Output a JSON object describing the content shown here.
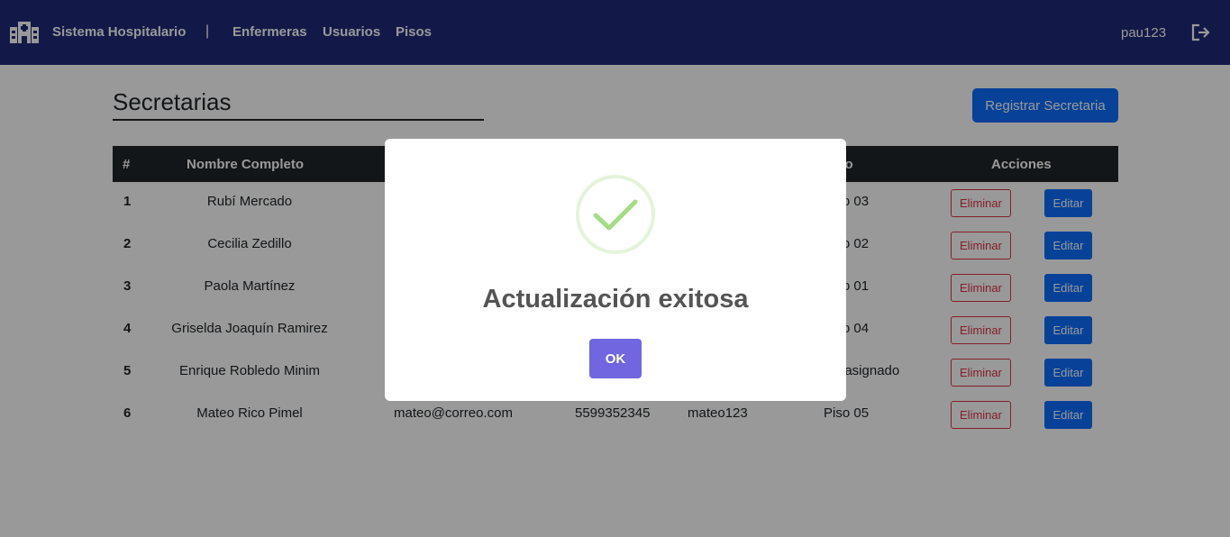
{
  "nav": {
    "brand": "Sistema Hospitalario",
    "separator": "|",
    "links": [
      "Enfermeras",
      "Usuarios",
      "Pisos"
    ],
    "user": "pau123"
  },
  "page": {
    "title": "Secretarias",
    "register_button": "Registrar Secretaria"
  },
  "table": {
    "headers": [
      "#",
      "Nombre Completo",
      "Piso",
      "Acciones"
    ],
    "rows": [
      {
        "num": "1",
        "name": "Rubí Mercado",
        "email": "",
        "phone": "",
        "user": "",
        "floor": "Piso 03"
      },
      {
        "num": "2",
        "name": "Cecilia Zedillo",
        "email": "",
        "phone": "",
        "user": "",
        "floor": "Piso 02"
      },
      {
        "num": "3",
        "name": "Paola Martínez",
        "email": "",
        "phone": "",
        "user": "",
        "floor": "Piso 01"
      },
      {
        "num": "4",
        "name": "Griselda Joaquín Ramirez",
        "email": "",
        "phone": "",
        "user": "",
        "floor": "Piso 04"
      },
      {
        "num": "5",
        "name": "Enrique Robledo Minim",
        "email": "",
        "phone": "",
        "user": "",
        "floor": "No asignado"
      },
      {
        "num": "6",
        "name": "Mateo Rico Pimel",
        "email": "mateo@correo.com",
        "phone": "5599352345",
        "user": "mateo123",
        "floor": "Piso 05"
      }
    ],
    "delete_label": "Eliminar",
    "edit_label": "Editar"
  },
  "modal": {
    "title": "Actualización exitosa",
    "ok_label": "OK"
  },
  "colors": {
    "navbar": "#1e2a78",
    "primary": "#0d6efd",
    "danger": "#dc3545",
    "confirm": "#7066e0",
    "success": "#a5dc86"
  }
}
